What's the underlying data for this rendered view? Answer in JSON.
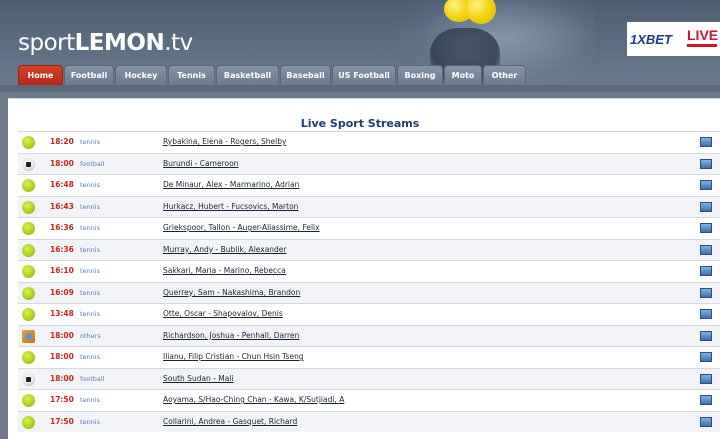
{
  "site": {
    "logo_prefix": "sport",
    "logo_main": "LEMON",
    "logo_suffix": ".tv"
  },
  "ad": {
    "brand": "1XBET",
    "badge": "LIVE"
  },
  "nav": [
    {
      "label": "Home",
      "active": true
    },
    {
      "label": "Football",
      "active": false
    },
    {
      "label": "Hockey",
      "active": false
    },
    {
      "label": "Tennis",
      "active": false
    },
    {
      "label": "Basketball",
      "active": false
    },
    {
      "label": "Baseball",
      "active": false
    },
    {
      "label": "US Football",
      "active": false
    },
    {
      "label": "Boxing",
      "active": false
    },
    {
      "label": "Moto",
      "active": false
    },
    {
      "label": "Other",
      "active": false
    }
  ],
  "page_title": "Live Sport Streams",
  "streams": [
    {
      "time": "18:20",
      "sport": "tennis",
      "icon": "tennis",
      "match": "Rybakina, Elena - Rogers, Shelby"
    },
    {
      "time": "18:00",
      "sport": "football",
      "icon": "football",
      "match": "Burundi - Cameroon"
    },
    {
      "time": "16:48",
      "sport": "tennis",
      "icon": "tennis",
      "match": "De Minaur, Alex - Marmarino, Adrian"
    },
    {
      "time": "16:43",
      "sport": "tennis",
      "icon": "tennis",
      "match": "Hurkacz, Hubert - Fucsovics, Marton"
    },
    {
      "time": "16:36",
      "sport": "tennis",
      "icon": "tennis",
      "match": "Griekspoor, Tallon - Auger-Aliassime, Felix"
    },
    {
      "time": "16:36",
      "sport": "tennis",
      "icon": "tennis",
      "match": "Murray, Andy - Bublik, Alexander"
    },
    {
      "time": "16:10",
      "sport": "tennis",
      "icon": "tennis",
      "match": "Sakkari, Maria - Marino, Rebecca"
    },
    {
      "time": "16:09",
      "sport": "tennis",
      "icon": "tennis",
      "match": "Querrey, Sam - Nakashima, Brandon"
    },
    {
      "time": "13:48",
      "sport": "tennis",
      "icon": "tennis",
      "match": "Otte, Oscar - Shapovalov, Denis"
    },
    {
      "time": "18:00",
      "sport": "others",
      "icon": "others",
      "match": "Richardson, Joshua - Penhall, Darren"
    },
    {
      "time": "18:00",
      "sport": "tennis",
      "icon": "tennis",
      "match": "Ilianu, Filip Cristian - Chun Hsin Tseng"
    },
    {
      "time": "18:00",
      "sport": "football",
      "icon": "football",
      "match": "South Sudan - Mali"
    },
    {
      "time": "17:50",
      "sport": "tennis",
      "icon": "tennis",
      "match": "Aoyama, S/Hao-Ching Chan - Kawa, K/Sutjiadi, A"
    },
    {
      "time": "17:50",
      "sport": "tennis",
      "icon": "tennis",
      "match": "Collarini, Andrea - Gasquet, Richard"
    }
  ],
  "colors": {
    "header": "#5e6f84",
    "active_tab": "#c5341f",
    "time": "#c4281e",
    "sport": "#5a7fb5"
  }
}
